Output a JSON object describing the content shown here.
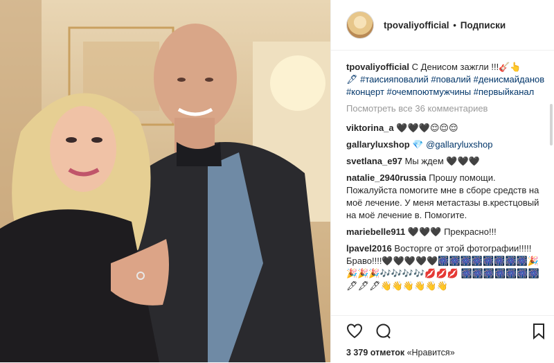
{
  "header": {
    "username": "tpovaliyofficial",
    "separator": "•",
    "follow_label": "Подписки"
  },
  "caption": {
    "username": "tpovaliyofficial",
    "text": "С Денисом зажгли !!!🎸👆",
    "hashtags": "🖋 #таисияповалий #повалий #денисмайданов #концерт #очемпоютмужчины #первыйканал"
  },
  "view_all_label": "Посмотреть все 36 комментариев",
  "comments": [
    {
      "user": "viktorina_a",
      "text": "🖤🖤🖤😌😌😌"
    },
    {
      "user": "gallaryluxshop",
      "text": "💎 @gallaryluxshop"
    },
    {
      "user": "svetlana_e97",
      "text": "Мы ждем 🖤🖤🖤"
    },
    {
      "user": "natalie_2940russia",
      "text": "Прошу помощи. Пожалуйста помогите мне в сборе средств на моё лечение. У меня метастазы в.крестцовый на моё лечение в. Помогите."
    },
    {
      "user": "mariebelle911",
      "text": "🖤🖤🖤 Прекрасно!!!"
    },
    {
      "user": "lpavel2016",
      "text": "Восторге от этой фотографии!!!!! Браво!!!!🖤🖤🖤🖤🖤🎆🎆🎆🎆🎆🎆🎆🎆🎉🎉🎉🎉🎶🎶🎶🎶💋💋💋 🎆🎆🎆🎆🎆🎆🎆🖋🖋🖋👋👋👋👋👋👋"
    }
  ],
  "actions": {
    "like_icon": "heart-icon",
    "comment_icon": "comment-icon",
    "save_icon": "bookmark-icon"
  },
  "likes": {
    "count_text": "3 379 отметок",
    "label": "«Нравится»"
  }
}
